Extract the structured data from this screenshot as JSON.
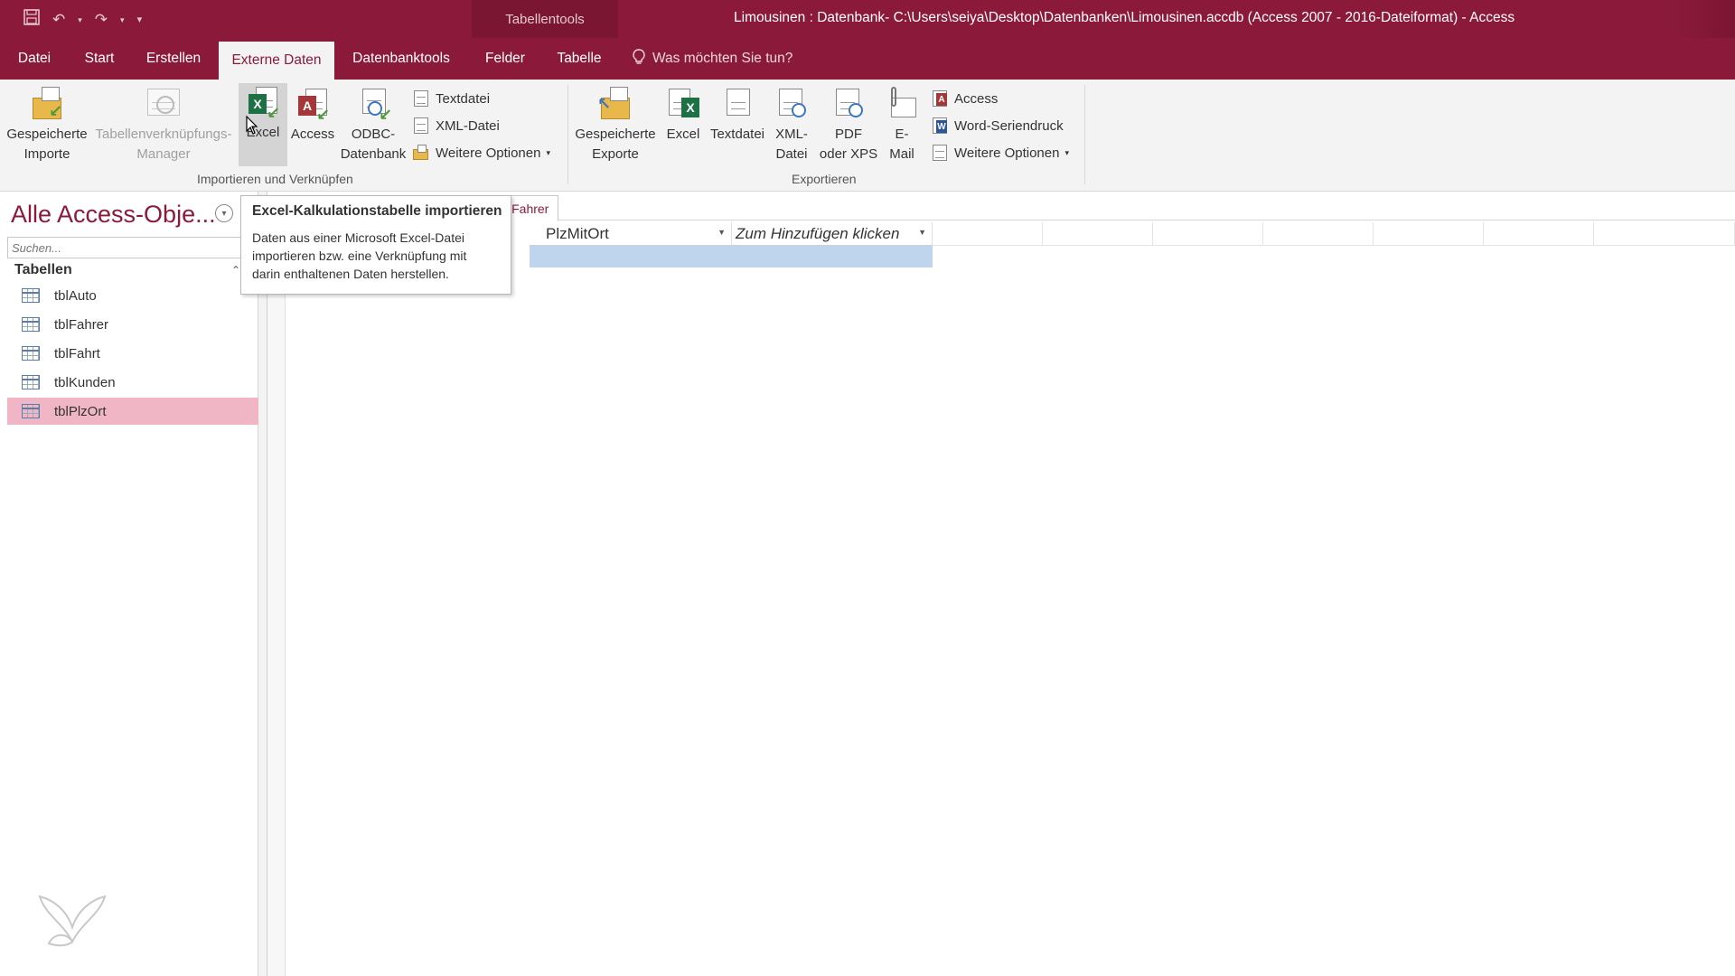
{
  "window": {
    "title": "Limousinen : Datenbank- C:\\Users\\seiya\\Desktop\\Datenbanken\\Limousinen.accdb (Access 2007 - 2016-Dateiformat)  -  Access",
    "context_tool": "Tabellentools",
    "accent_color": "#8b1a3a"
  },
  "tabs": [
    {
      "label": "Datei"
    },
    {
      "label": "Start"
    },
    {
      "label": "Erstellen"
    },
    {
      "label": "Externe Daten",
      "active": true
    },
    {
      "label": "Datenbanktools"
    },
    {
      "label": "Felder"
    },
    {
      "label": "Tabelle"
    }
  ],
  "tell_me": "Was möchten Sie tun?",
  "ribbon": {
    "import_group": {
      "label": "Importieren und Verknüpfen",
      "saved_imports": "Gespeicherte\nImporte",
      "saved_imports_l1": "Gespeicherte",
      "saved_imports_l2": "Importe",
      "linked_table_mgr_l1": "Tabellenverknüpfungs-",
      "linked_table_mgr_l2": "Manager",
      "excel": "Excel",
      "access": "Access",
      "odbc_l1": "ODBC-",
      "odbc_l2": "Datenbank",
      "textfile": "Textdatei",
      "xmlfile": "XML-Datei",
      "more": "Weitere Optionen"
    },
    "export_group": {
      "label": "Exportieren",
      "saved_exports_l1": "Gespeicherte",
      "saved_exports_l2": "Exporte",
      "excel": "Excel",
      "textfile": "Textdatei",
      "xml_l1": "XML-",
      "xml_l2": "Datei",
      "pdf_l1": "PDF",
      "pdf_l2": "oder XPS",
      "email_l1": "E-",
      "email_l2": "Mail",
      "access": "Access",
      "word_merge": "Word-Seriendruck",
      "more": "Weitere Optionen"
    }
  },
  "nav": {
    "title": "Alle Access-Obje...",
    "search_placeholder": "Suchen...",
    "group": "Tabellen",
    "items": [
      {
        "label": "tblAuto"
      },
      {
        "label": "tblFahrer"
      },
      {
        "label": "tblFahrt"
      },
      {
        "label": "tblKunden"
      },
      {
        "label": "tblPlzOrt",
        "selected": true
      }
    ]
  },
  "document": {
    "tab_label": "lFahrer",
    "columns": [
      {
        "label": "PlzMitOrt"
      },
      {
        "label": "Zum Hinzufügen klicken"
      }
    ]
  },
  "tooltip": {
    "title": "Excel-Kalkulationstabelle importieren",
    "line1": "Daten aus einer Microsoft Excel-Datei",
    "line2": "importieren bzw. eine Verknüpfung mit",
    "line3": "darin enthaltenen Daten herstellen."
  }
}
